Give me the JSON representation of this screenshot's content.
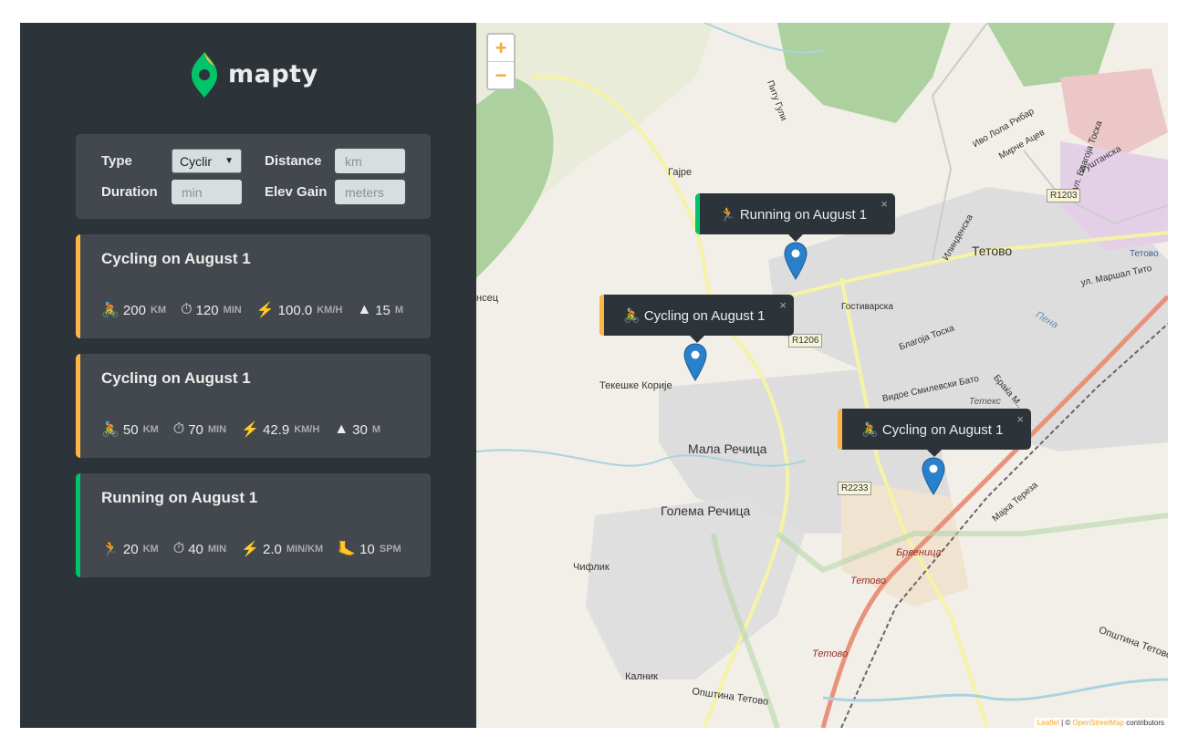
{
  "logo": {
    "text": "mapty"
  },
  "form": {
    "type_label": "Type",
    "type_value": "Cyclir",
    "distance_label": "Distance",
    "distance_placeholder": "km",
    "duration_label": "Duration",
    "duration_placeholder": "min",
    "elev_label": "Elev Gain",
    "elev_placeholder": "meters"
  },
  "workouts": [
    {
      "title": "Cycling on August 1",
      "accent": "#ffb545",
      "stats": [
        {
          "icon": "🚴",
          "value": "200",
          "unit": "km"
        },
        {
          "icon": "⏱",
          "value": "120",
          "unit": "min"
        },
        {
          "icon": "⚡",
          "value": "100.0",
          "unit": "km/h"
        },
        {
          "icon": "▲",
          "value": "15",
          "unit": "m"
        }
      ]
    },
    {
      "title": "Cycling on August 1",
      "accent": "#ffb545",
      "stats": [
        {
          "icon": "🚴",
          "value": "50",
          "unit": "km"
        },
        {
          "icon": "⏱",
          "value": "70",
          "unit": "min"
        },
        {
          "icon": "⚡",
          "value": "42.9",
          "unit": "km/h"
        },
        {
          "icon": "▲",
          "value": "30",
          "unit": "m"
        }
      ]
    },
    {
      "title": "Running on August 1",
      "accent": "#00c46a",
      "stats": [
        {
          "icon": "🏃",
          "value": "20",
          "unit": "km"
        },
        {
          "icon": "⏱",
          "value": "40",
          "unit": "min"
        },
        {
          "icon": "⚡",
          "value": "2.0",
          "unit": "min/km"
        },
        {
          "icon": "🦶",
          "value": "10",
          "unit": "spm"
        }
      ]
    }
  ],
  "map": {
    "zoom_in": "+",
    "zoom_out": "−",
    "popups": [
      {
        "text": "🏃 Running on August 1",
        "accent": "#00c46a"
      },
      {
        "text": "🚴 Cycling on August 1",
        "accent": "#ffb545"
      },
      {
        "text": "🚴 Cycling on August 1",
        "accent": "#ffb545"
      }
    ],
    "close_glyph": "×",
    "labels": {
      "tetovo": "Тетово",
      "gajre": "Гајре",
      "mala": "Мала Речица",
      "golema": "Голема Речица",
      "tekeshke": "Текешке Корије",
      "chiflik": "Чифлик",
      "kalnik": "Калник",
      "opshtina": "Општина Тетово",
      "opshtina2": "Општина Тетово",
      "brvenica": "Брвеница",
      "tetovo_red1": "Тетово",
      "tetovo_red2": "Тетово",
      "tetovo_station": "Тетово",
      "pitu_guli": "Питу Гули",
      "gostivarska": "Гостиварска",
      "iliden": "Илинденска",
      "blagoja": "Благоја Тоска",
      "vidoe": "Видое Смилевски Бато",
      "marshal": "ул. Маршал Тито",
      "majka": "Мајка Тереза",
      "tetex": "Тетекс",
      "pena": "Пена",
      "brakja": "Браќа М...",
      "ivo": "Иво Лола Рибар",
      "mirche": "Мирче Ацев",
      "fushtanska": "Фуштанска",
      "blagoja2": "ул. Благоја Тоска",
      "brsets": "нсец"
    },
    "badges": {
      "r1203": "R1203",
      "r1206": "R1206",
      "r2233": "R2233"
    },
    "attrib_leaflet": "Leaflet",
    "attrib_sep": " | © ",
    "attrib_osm": "OpenStreetMap",
    "attrib_contrib": " contributors"
  }
}
